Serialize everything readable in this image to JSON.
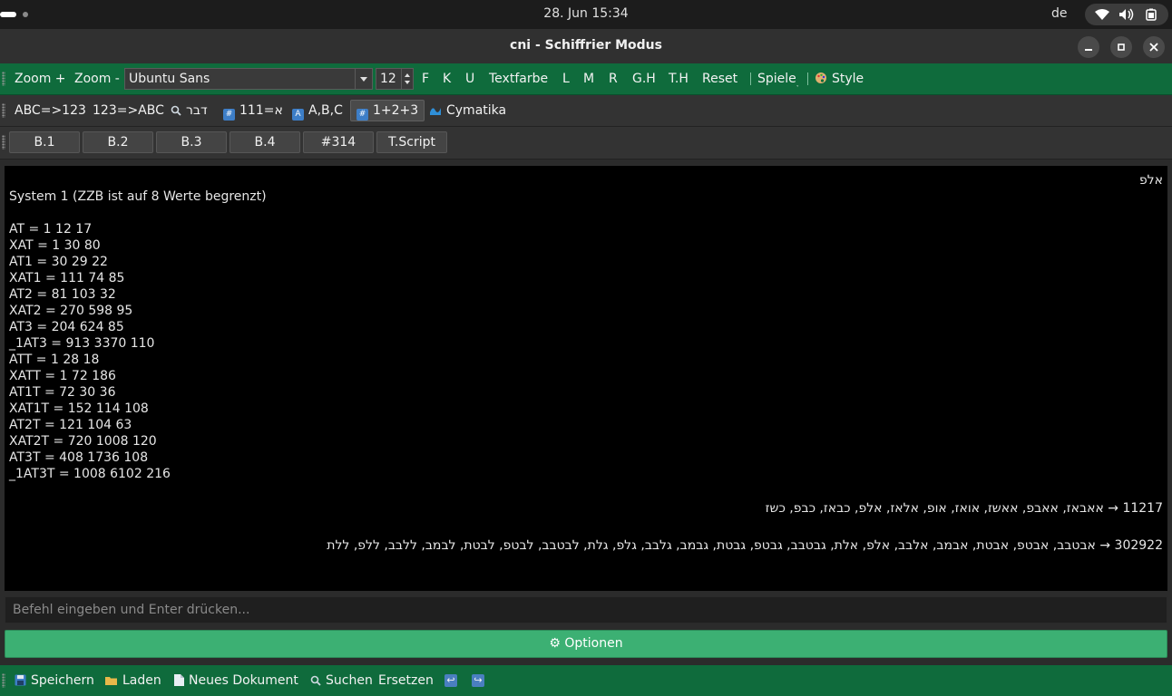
{
  "system": {
    "clock": "28. Jun  15:34",
    "lang": "de"
  },
  "window": {
    "title": "cni - Schiffrier Modus"
  },
  "toolbar1": {
    "zoom_in": "Zoom +",
    "zoom_out": "Zoom -",
    "font": "Ubuntu Sans",
    "size": "12",
    "bold": "F",
    "italic": "K",
    "underline": "U",
    "textcolor": "Textfarbe",
    "left": "L",
    "middle": "M",
    "right": "R",
    "gh": "G.H",
    "th": "T.H",
    "reset": "Reset",
    "games": "Spiele",
    "style": "Style"
  },
  "toolbar2": {
    "abc123": "ABC=>123",
    "num_abc": "123=>ABC",
    "dabar": "דבר",
    "num111": "111=א",
    "abc_cat": "A,B,C",
    "sum": "1+2+3",
    "cymatika": "Cymatika"
  },
  "toolbar3": {
    "tabs": [
      "B.1",
      "B.2",
      "B.3",
      "B.4",
      "#314",
      "T.Script"
    ]
  },
  "output": {
    "heb_title": "אלפ",
    "system_line": "System 1 (ZZB ist auf 8 Werte begrenzt)",
    "lines": [
      "AT = 1 12 17",
      "XAT = 1 30 80",
      "AT1 = 30 29 22",
      "XAT1 = 111 74 85",
      "AT2 = 81 103 32",
      "XAT2 = 270 598 95",
      "AT3 = 204 624 85",
      "_1AT3 = 913 3370 110",
      "ATT = 1 28 18",
      "XATT = 1 72 186",
      "AT1T = 72 30 36",
      "XAT1T = 152 114 108",
      "AT2T = 121 104 63",
      "XAT2T = 720 1008 120",
      "AT3T = 408 1736 108",
      "_1AT3T = 1008 6102 216"
    ],
    "result1": "11217 → אאבאז, אאבפ, אאשז, אואז, אופ, אלאז, אלפ, כבאז, כבפ, כשז",
    "result2": "302922 → אבטבב, אבטפ, אבטת, אבמב, אלבב, אלפ, אלת, גבטבב, גבטפ, גבטת, גבמב, גלבב, גלפ, גלת, לבטבב, לבטפ, לבטת, לבמב, ללבב, ללפ, ללת"
  },
  "command": {
    "placeholder": "Befehl eingeben und Enter drücken..."
  },
  "options": {
    "label": "⚙ Optionen"
  },
  "bottom": {
    "save": "Speichern",
    "load": "Laden",
    "new_doc": "Neues Dokument",
    "search": "Suchen",
    "replace": "Ersetzen"
  }
}
